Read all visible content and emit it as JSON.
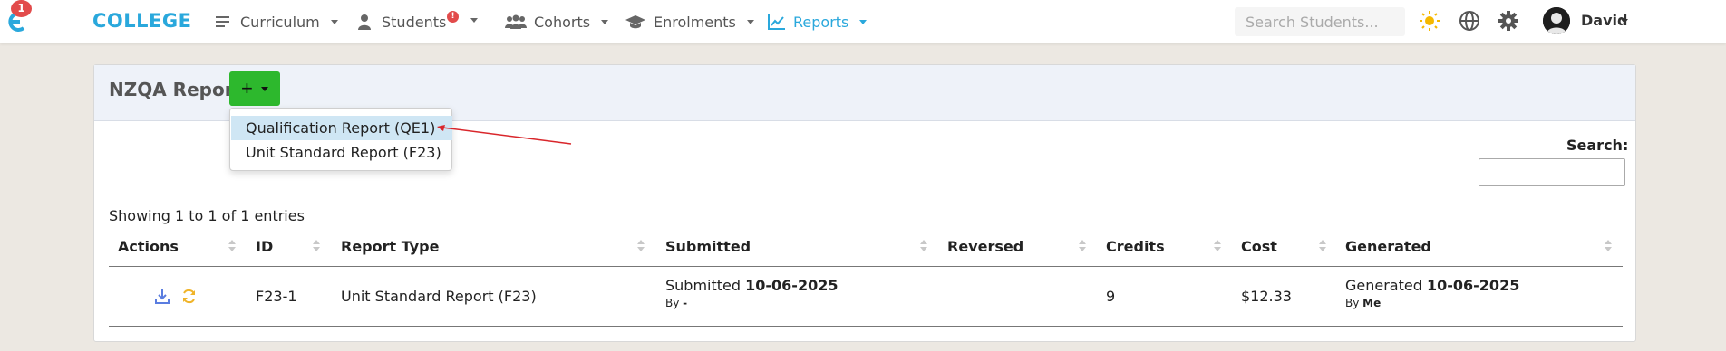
{
  "nav": {
    "logo_badge": "1",
    "brand": "COLLEGE",
    "items": [
      {
        "label": "Curriculum",
        "icon": "list-icon"
      },
      {
        "label": "Students",
        "icon": "user-icon",
        "badge": "!"
      },
      {
        "label": "Cohorts",
        "icon": "users-icon"
      },
      {
        "label": "Enrolments",
        "icon": "graduation-cap-icon"
      },
      {
        "label": "Reports",
        "icon": "chart-line-icon",
        "active": true
      }
    ],
    "search_placeholder": "Search Students...",
    "user_name": "David",
    "colors": {
      "accent": "#2aa8dc",
      "badge": "#e24b4b",
      "add_button": "#2db82d"
    }
  },
  "card": {
    "title": "NZQA Report",
    "add_button_label": "+",
    "dropdown": {
      "items": [
        {
          "label": "Qualification Report (QE1)",
          "highlighted": true
        },
        {
          "label": "Unit Standard Report (F23)",
          "highlighted": false
        }
      ]
    },
    "search_label": "Search:",
    "showing_text": "Showing 1 to 1 of 1 entries",
    "table": {
      "headers": [
        "Actions",
        "ID",
        "Report Type",
        "Submitted",
        "Reversed",
        "Credits",
        "Cost",
        "Generated"
      ],
      "rows": [
        {
          "id": "F23-1",
          "report_type": "Unit Standard Report (F23)",
          "submitted_prefix": "Submitted",
          "submitted_date": "10-06-2025",
          "submitted_by_prefix": "By",
          "submitted_by": "-",
          "reversed": "",
          "credits": "9",
          "cost": "$12.33",
          "generated_prefix": "Generated",
          "generated_date": "10-06-2025",
          "generated_by_prefix": "By",
          "generated_by": "Me"
        }
      ]
    }
  }
}
